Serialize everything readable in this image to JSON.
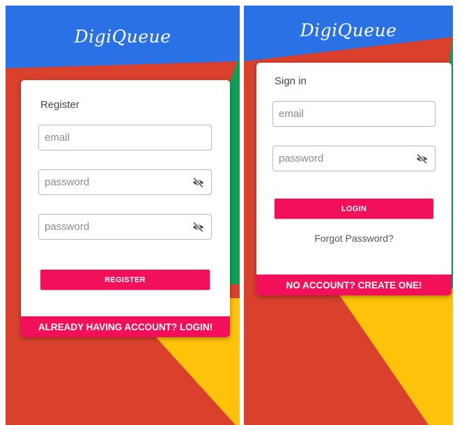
{
  "app": {
    "logo_text": "DigiQueue"
  },
  "colors": {
    "blue": "#2b71e6",
    "red": "#d9412c",
    "green": "#10a055",
    "yellow": "#fdc209",
    "accent": "#f2105a"
  },
  "register_screen": {
    "title": "Register",
    "email": {
      "placeholder": "email",
      "value": ""
    },
    "password": {
      "placeholder": "password",
      "value": "",
      "toggle_icon": "eye-off-icon"
    },
    "confirm_password": {
      "placeholder": "password",
      "value": "",
      "toggle_icon": "eye-off-icon"
    },
    "register_button_label": "REGISTER",
    "login_link_label": "ALREADY HAVING ACCOUNT? LOGIN!"
  },
  "signin_screen": {
    "title": "Sign in",
    "email": {
      "placeholder": "email",
      "value": ""
    },
    "password": {
      "placeholder": "password",
      "value": "",
      "toggle_icon": "eye-off-icon"
    },
    "login_button_label": "LOGIN",
    "forgot_password_label": "Forgot Password?",
    "create_account_label": "NO ACCOUNT? CREATE ONE!"
  }
}
